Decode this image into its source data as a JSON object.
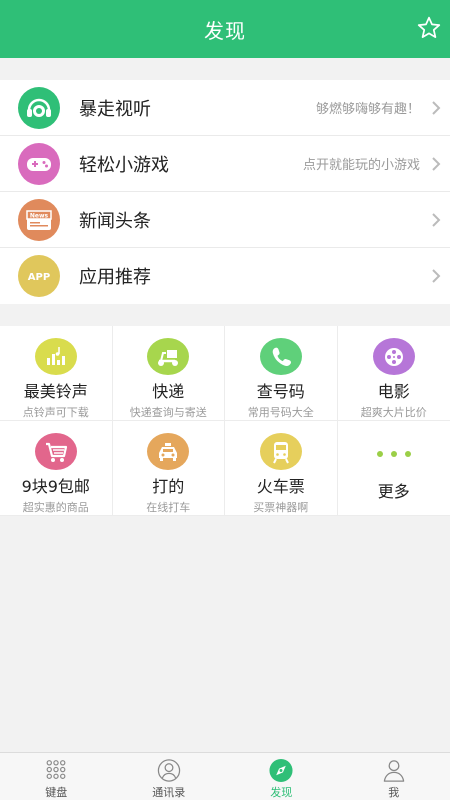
{
  "header": {
    "title": "发现"
  },
  "list": [
    {
      "label": "暴走视听",
      "sub": "够燃够嗨够有趣！",
      "color": "#2fbf77",
      "icon": "headphones-face-icon"
    },
    {
      "label": "轻松小游戏",
      "sub": "点开就能玩的小游戏",
      "color": "#d96bbd",
      "icon": "gamepad-icon"
    },
    {
      "label": "新闻头条",
      "sub": "",
      "color": "#e08a5c",
      "icon": "news-icon",
      "badge": "News"
    },
    {
      "label": "应用推荐",
      "sub": "",
      "color": "#e0c75c",
      "icon": "app-icon",
      "badge": "APP"
    }
  ],
  "grid": [
    {
      "name": "最美铃声",
      "sub": "点铃声可下载",
      "color": "#d9dc4d",
      "icon": "music-equalizer-icon"
    },
    {
      "name": "快递",
      "sub": "快递查询与寄送",
      "color": "#a7d64d",
      "icon": "scooter-icon"
    },
    {
      "name": "查号码",
      "sub": "常用号码大全",
      "color": "#5fd07a",
      "icon": "phone-icon"
    },
    {
      "name": "电影",
      "sub": "超爽大片比价",
      "color": "#b676d8",
      "icon": "film-reel-icon"
    },
    {
      "name": "9块9包邮",
      "sub": "超实惠的商品",
      "color": "#e2668c",
      "icon": "shopping-cart-icon"
    },
    {
      "name": "打的",
      "sub": "在线打车",
      "color": "#e5a75c",
      "icon": "taxi-icon"
    },
    {
      "name": "火车票",
      "sub": "买票神器啊",
      "color": "#e6cf5c",
      "icon": "train-icon"
    },
    {
      "name": "更多",
      "sub": "",
      "color": "#9bcf47",
      "icon": "more-dots-icon"
    }
  ],
  "tabs": [
    {
      "label": "键盘",
      "icon": "keypad-icon",
      "active": false
    },
    {
      "label": "通讯录",
      "icon": "contacts-icon",
      "active": false
    },
    {
      "label": "发现",
      "icon": "compass-icon",
      "active": true
    },
    {
      "label": "我",
      "icon": "person-icon",
      "active": false
    }
  ],
  "colors": {
    "accent": "#2fbf77"
  }
}
